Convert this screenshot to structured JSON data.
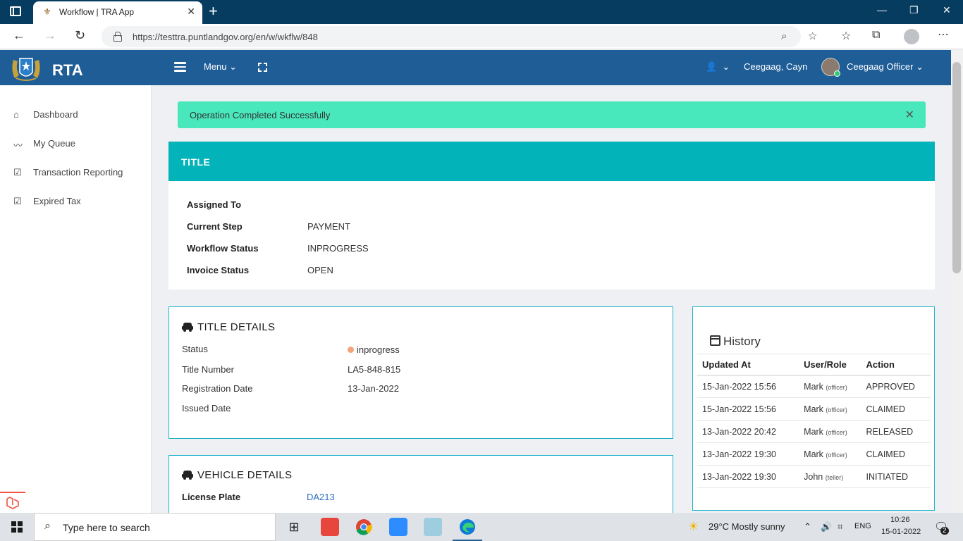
{
  "browser": {
    "tab_title": "Workflow | TRA App",
    "url": "https://testtra.puntlandgov.org/en/w/wkflw/848"
  },
  "header": {
    "brand": "RTA",
    "menu_label": "Menu",
    "user_name": "Ceegaag, Cayn",
    "role": "Ceegaag Officer"
  },
  "sidebar": {
    "items": [
      {
        "label": "Dashboard",
        "icon": "home-icon"
      },
      {
        "label": "My Queue",
        "icon": "trend-icon"
      },
      {
        "label": "Transaction Reporting",
        "icon": "checkbox-icon"
      },
      {
        "label": "Expired Tax",
        "icon": "checkbox-icon"
      }
    ]
  },
  "alert": {
    "message": "Operation Completed Successfully"
  },
  "title_card": {
    "heading": "TITLE",
    "fields": [
      {
        "label": "Assigned To",
        "value": ""
      },
      {
        "label": "Current Step",
        "value": "PAYMENT"
      },
      {
        "label": "Workflow Status",
        "value": "INPROGRESS"
      },
      {
        "label": "Invoice Status",
        "value": "OPEN"
      }
    ]
  },
  "title_details": {
    "heading": "TITLE DETAILS",
    "fields": [
      {
        "label": "Status",
        "value": "inprogress"
      },
      {
        "label": "Title Number",
        "value": "LA5-848-815"
      },
      {
        "label": "Registration Date",
        "value": "13-Jan-2022"
      },
      {
        "label": "Issued Date",
        "value": ""
      }
    ]
  },
  "vehicle_details": {
    "heading": "VEHICLE DETAILS",
    "license_label": "License Plate",
    "license_value": "DA213"
  },
  "history": {
    "heading": "History",
    "columns": [
      "Updated At",
      "User/Role",
      "Action"
    ],
    "rows": [
      {
        "updated": "15-Jan-2022 15:56",
        "user": "Mark",
        "role": "(officer)",
        "action": "APPROVED"
      },
      {
        "updated": "15-Jan-2022 15:56",
        "user": "Mark",
        "role": "(officer)",
        "action": "CLAIMED"
      },
      {
        "updated": "13-Jan-2022 20:42",
        "user": "Mark",
        "role": "(officer)",
        "action": "RELEASED"
      },
      {
        "updated": "13-Jan-2022 19:30",
        "user": "Mark",
        "role": "(officer)",
        "action": "CLAIMED"
      },
      {
        "updated": "13-Jan-2022 19:30",
        "user": "John",
        "role": "(teller)",
        "action": "INITIATED"
      }
    ]
  },
  "taskbar": {
    "search_placeholder": "Type here to search",
    "weather": "29°C  Mostly sunny",
    "lang": "ENG",
    "time": "10:26",
    "date": "15-01-2022",
    "notifications": "2"
  },
  "colors": {
    "header": "#1f5d97",
    "teal": "#02b3b9",
    "success": "#48e8bc"
  }
}
